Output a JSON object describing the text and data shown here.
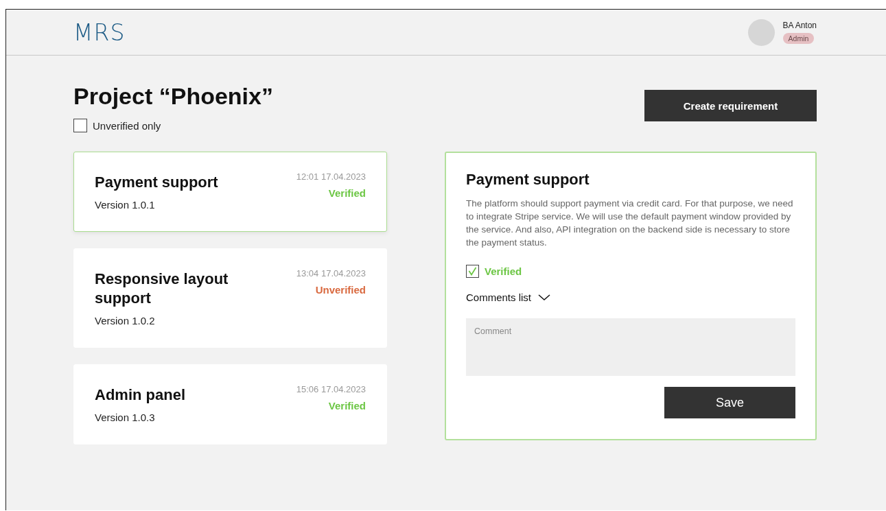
{
  "header": {
    "logo": "MRS",
    "user": {
      "name": "BA Anton",
      "role": "Admin"
    }
  },
  "page": {
    "title": "Project “Phoenix”",
    "filter": {
      "label": "Unverified only",
      "checked": false
    },
    "create_button": "Create requirement"
  },
  "requirements": [
    {
      "title": "Payment support",
      "version": "Version 1.0.1",
      "time": "12:01 17.04.2023",
      "status": "Verified",
      "verified": true,
      "selected": true
    },
    {
      "title": "Responsive layout support",
      "version": "Version 1.0.2",
      "time": "13:04 17.04.2023",
      "status": "Unverified",
      "verified": false,
      "selected": false
    },
    {
      "title": "Admin panel",
      "version": "Version 1.0.3",
      "time": "15:06 17.04.2023",
      "status": "Verified",
      "verified": true,
      "selected": false
    }
  ],
  "detail": {
    "title": "Payment support",
    "description": "The platform should support payment via credit card. For that purpose, we need to integrate Stripe service. We will use the default payment window provided by the service. And also, API integration on the backend side is necessary to store the payment status.",
    "verified": {
      "label": "Verified",
      "checked": true
    },
    "comments_toggle": {
      "label": "Comments list",
      "expanded": false
    },
    "comment": {
      "placeholder": "Comment"
    },
    "save_button": "Save"
  }
}
